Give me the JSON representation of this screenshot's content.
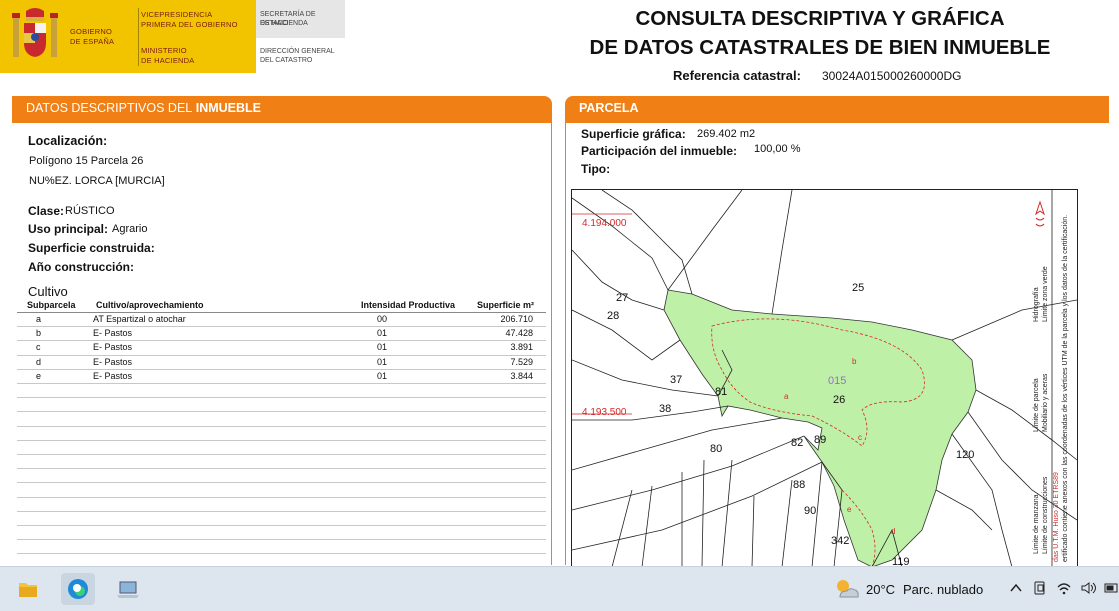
{
  "header": {
    "logo": {
      "gobierno": [
        "GOBIERNO",
        "DE ESPAÑA"
      ],
      "vicepresidencia": [
        "VICEPRESIDENCIA",
        "PRIMERA DEL GOBIERNO"
      ],
      "ministerio": [
        "MINISTERIO",
        "DE HACIENDA"
      ],
      "secretaria": [
        "SECRETARÍA DE ESTADO",
        "DE HACIENDA"
      ],
      "direccion": [
        "DIRECCIÓN GENERAL",
        "DEL CATASTRO"
      ]
    },
    "title_line1": "CONSULTA DESCRIPTIVA Y GRÁFICA",
    "title_line2": "DE DATOS CATASTRALES DE BIEN INMUEBLE",
    "ref_label": "Referencia catastral:",
    "ref_value": "30024A015000260000DG"
  },
  "left": {
    "section_title": "DATOS DESCRIPTIVOS DEL",
    "section_title_bold": "INMUEBLE",
    "localizacion_label": "Localización:",
    "localizacion_line1": "Polígono 15 Parcela 26",
    "localizacion_line2": "NU%EZ. LORCA [MURCIA]",
    "clase_label": "Clase:",
    "clase_value": "RÚSTICO",
    "uso_label": "Uso principal:",
    "uso_value": "Agrario",
    "superficie_label": "Superficie construida:",
    "anio_label": "Año construcción:",
    "cultivo_title": "Cultivo",
    "table": {
      "headers": [
        "Subparcela",
        "Cultivo/aprovechamiento",
        "Intensidad Productiva",
        "Superficie m²"
      ],
      "rows": [
        [
          "a",
          "AT Espartizal o atochar",
          "00",
          "206.710"
        ],
        [
          "b",
          "E- Pastos",
          "01",
          "47.428"
        ],
        [
          "c",
          "E- Pastos",
          "01",
          "3.891"
        ],
        [
          "d",
          "E- Pastos",
          "01",
          "7.529"
        ],
        [
          "e",
          "E- Pastos",
          "01",
          "3.844"
        ]
      ]
    }
  },
  "right": {
    "section_title": "PARCELA",
    "sup_label": "Superficie gráfica:",
    "sup_value": "269.402 m2",
    "part_label": "Participación del inmueble:",
    "part_value": "100,00 %",
    "tipo_label": "Tipo:",
    "map": {
      "coord_top": "4.194.000",
      "coord_mid": "4.193.500",
      "parcel_id": "015",
      "labels": [
        "25",
        "27",
        "28",
        "37",
        "81",
        "38",
        "26",
        "80",
        "82",
        "89",
        "120",
        "88",
        "90",
        "342",
        "119"
      ],
      "subparcels": [
        "a",
        "b",
        "c",
        "d",
        "e"
      ],
      "legend_col1": [
        "Límite de manzana",
        "Límite de construcciones"
      ],
      "legend_col2": [
        "Límite de parcela",
        "Mobiliario y aceras"
      ],
      "legend_col3": [
        "Hidrografía",
        "Límite zona verde"
      ],
      "note1": "das U.T.M. Huso 30 ETRS89",
      "note2": "ertificado contiene anexos con las coordenadas de los vértices UTM de la parcela y los datos de la certificación."
    }
  },
  "taskbar": {
    "temperature": "20°C",
    "condition": "Parc. nublado"
  },
  "colors": {
    "accent_orange": "#f07f15",
    "logo_yellow": "#f2c400",
    "parcel_green": "#bff0a8",
    "coord_red": "#d42a2a"
  }
}
